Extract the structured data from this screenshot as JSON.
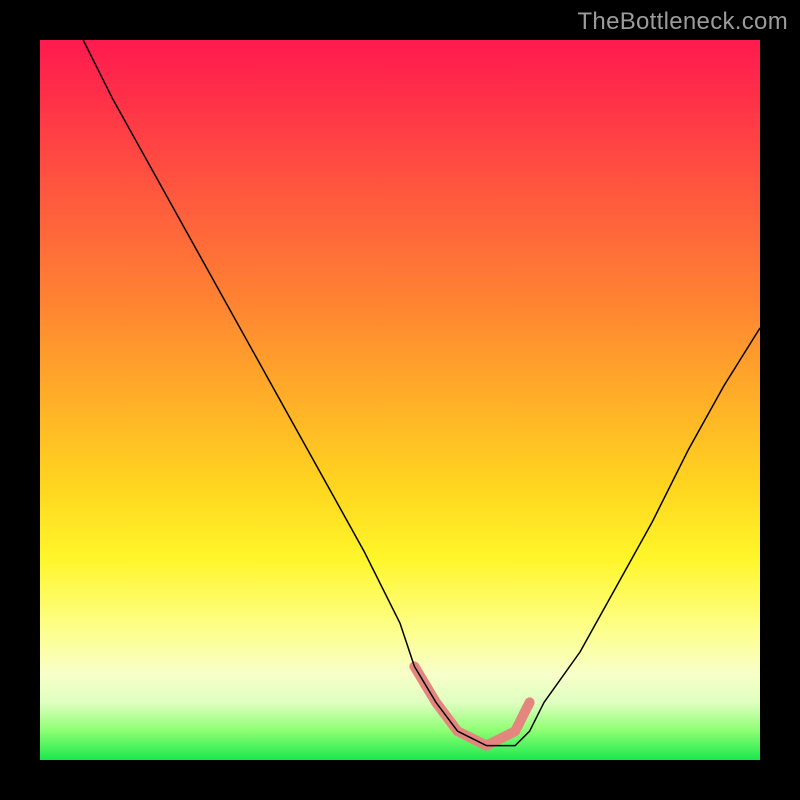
{
  "attribution": {
    "watermark": "TheBottleneck.com"
  },
  "chart_data": {
    "type": "line",
    "title": "",
    "xlabel": "",
    "ylabel": "",
    "xlim": [
      0,
      100
    ],
    "ylim": [
      0,
      100
    ],
    "grid": false,
    "legend": false,
    "background": "rainbow-vertical-gradient",
    "series": [
      {
        "name": "bottleneck-curve",
        "color": "#000000",
        "stroke_width": 1.5,
        "x": [
          6,
          10,
          15,
          20,
          25,
          30,
          35,
          40,
          45,
          50,
          52,
          55,
          58,
          62,
          66,
          68,
          70,
          75,
          80,
          85,
          90,
          95,
          100
        ],
        "values": [
          100,
          92,
          83,
          74,
          65,
          56,
          47,
          38,
          29,
          19,
          13,
          8,
          4,
          2,
          2,
          4,
          8,
          15,
          24,
          33,
          43,
          52,
          60
        ]
      },
      {
        "name": "optimal-band",
        "color": "#E4867E",
        "stroke_width": 10,
        "x": [
          52,
          55,
          58,
          62,
          66,
          68
        ],
        "values": [
          13,
          8,
          4,
          2,
          4,
          8
        ]
      }
    ],
    "annotations": []
  }
}
